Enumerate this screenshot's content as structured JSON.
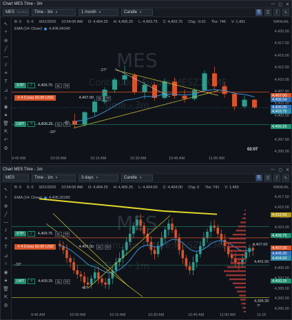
{
  "top": {
    "title": "Chart MES Time - 3m",
    "symbol": "MES",
    "symbol_placeholder": "Symbol",
    "timeframe": "Time - 3m",
    "range": "1 month",
    "style": "Candle",
    "ohlc": {
      "b": "B: 0",
      "s": "S: 0",
      "date": "9/21/2023",
      "time": "10:54:00 AM",
      "o": "O: 4,404.25",
      "h": "H: 4,405.25",
      "l": "L: 4,403.75",
      "c": "C: 4,403.75",
      "chg": "Chg: -0.01",
      "tks": "Tks: 746",
      "v": "V: 1,491"
    },
    "ema": "EMA (14: Close)",
    "ema_value": "4,406.04140",
    "watermark": "MES",
    "watermark_sub": "Continuous Future:MESZ3.CME",
    "watermark_time": "Time - 3m",
    "manual": "MANUAL",
    "y_ticks": [
      "4,420.00",
      "4,417.50",
      "4,415.00",
      "4,412.50",
      "4,410.00",
      "4,407.50",
      "4,405.00",
      "4,402.50",
      "4,400.00",
      "4,397.50",
      "4,395.00"
    ],
    "price_tags": [
      {
        "text": "4,407.00",
        "color": "#d9542a"
      },
      {
        "text": "4,406.04",
        "color": "#2f6eb5"
      },
      {
        "text": "4,405.00",
        "color": "#2f6eb5"
      },
      {
        "text": "4,403.75",
        "color": "#2e8aa8"
      },
      {
        "text": "4,400.25",
        "color": "#1f8f6e"
      }
    ],
    "x_ticks": [
      "9:45 AM",
      "10:00 AM",
      "10:15 AM",
      "10:30 AM",
      "10:45 AM",
      "11:00 AM"
    ],
    "orders": {
      "stp": {
        "label": "STP",
        "qty": "2",
        "price": "4,409.75"
      },
      "cross": {
        "label": "Cross 60.00 USD",
        "qty": "4",
        "price": "4,407.00"
      },
      "lmt": {
        "label": "LMT",
        "qty": "4",
        "price": "4,400.25"
      }
    },
    "annotations": [
      "-27°",
      "-5°",
      "-33°"
    ],
    "countdown": "02:07"
  },
  "bottom": {
    "title": "Chart MES Time - 1m",
    "symbol": "MES",
    "timeframe": "Time - 1m",
    "range": "3 days",
    "style": "Candle",
    "ohlc": {
      "b": "B: 0",
      "s": "S: 0",
      "date": "9/21/2023",
      "time": "10:54:00 AM",
      "o": "O: 4,404.25",
      "h": "H: 4,405.25",
      "l": "L: 4,404.00",
      "c": "C: 4,404.00",
      "chg": "Chg: 0",
      "tks": "Tks: 741",
      "v": "V: 1,460"
    },
    "ema": "EMA (14: Close)",
    "ema_value": "4,405.20180",
    "watermark": "MES",
    "watermark_sub": "Continuous Future:MESZ3.CME",
    "watermark_time": "Time - 1m",
    "manual": "MANUAL",
    "y_ticks": [
      "4,417.50",
      "4,415.00",
      "4,412.50",
      "4,410.00",
      "4,407.50",
      "4,405.00",
      "4,402.50",
      "4,400.00",
      "4,397.50",
      "4,395.00",
      "4,392.50",
      "4,390.00"
    ],
    "price_tags": [
      {
        "text": "4,412.56",
        "color": "#b59a1a"
      },
      {
        "text": "4,409.75",
        "color": "#1f8f6e"
      },
      {
        "text": "4,407.00",
        "color": "#d9542a"
      },
      {
        "text": "4,405.20",
        "color": "#2f6eb5"
      },
      {
        "text": "4,404.00",
        "color": "#2e8aa8"
      },
      {
        "text": "4,400.25",
        "color": "#1f8f6e"
      }
    ],
    "side_labels": [
      "4,407.00",
      "4,401.50",
      "4,395.30"
    ],
    "x_ticks": [
      "9:45 AM",
      "10:00 AM",
      "10:15 AM",
      "10:30 AM",
      "10:45 AM",
      "11:00 AM",
      "11:15"
    ],
    "orders": {
      "stp": {
        "label": "STP",
        "qty": "2",
        "price": "4,409.75"
      },
      "cross": {
        "label": "Cross 60.00 USD",
        "qty": "4",
        "price": "4,407.00"
      },
      "lmt": {
        "label": "LMT",
        "qty": "4",
        "price": "4,400.25"
      }
    },
    "annotations": [
      "-33°",
      "46°",
      "7°"
    ]
  },
  "colors": {
    "up": "#2e9e8f",
    "down": "#d9542a",
    "ema": "#3d8fd9",
    "trend": "#d8c83a"
  }
}
